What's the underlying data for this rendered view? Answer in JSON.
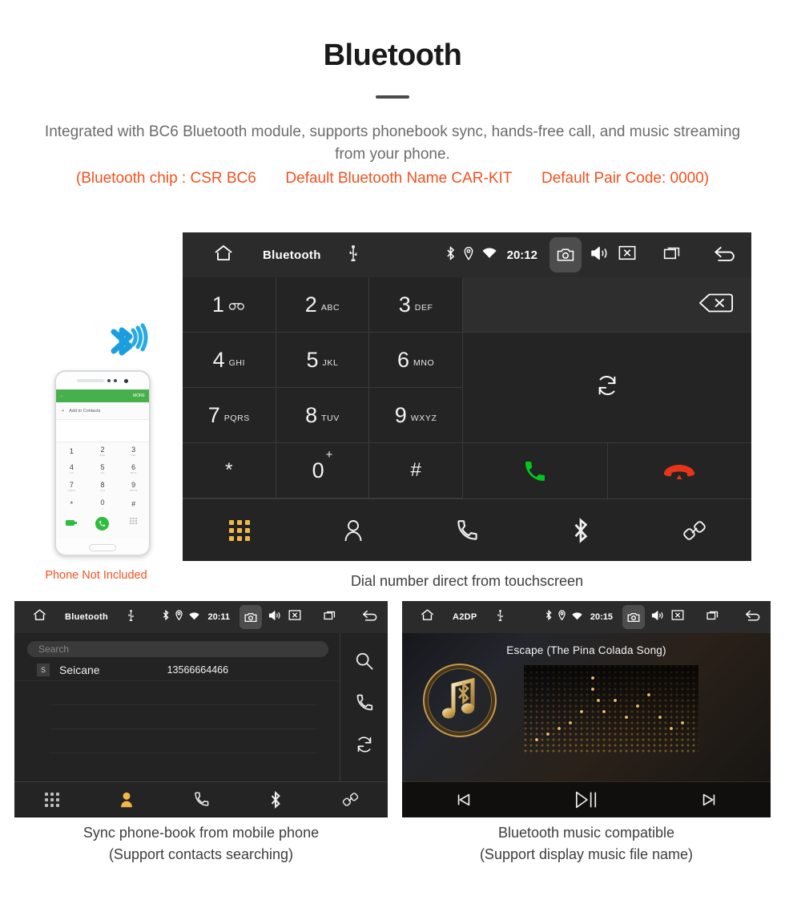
{
  "header": {
    "title": "Bluetooth",
    "description": "Integrated with BC6 Bluetooth module, supports phonebook sync, hands-free call, and music streaming from your phone.",
    "spec_open": "(Bluetooth chip : CSR BC6",
    "spec_name": "Default Bluetooth Name CAR-KIT",
    "spec_pair": "Default Pair Code: 0000)",
    "accent_color": "#f4511e"
  },
  "dialer": {
    "statusbar": {
      "title": "Bluetooth",
      "time": "20:12",
      "icons": [
        "home-icon",
        "usb-icon",
        "bluetooth-icon",
        "location-icon",
        "wifi-icon",
        "camera-icon",
        "volume-icon",
        "close-box-icon",
        "recents-icon",
        "back-icon"
      ]
    },
    "keys": [
      {
        "num": "1",
        "sub": "",
        "icon": "voicemail-icon"
      },
      {
        "num": "2",
        "sub": "ABC",
        "icon": ""
      },
      {
        "num": "3",
        "sub": "DEF",
        "icon": ""
      },
      {
        "num": "4",
        "sub": "GHI",
        "icon": ""
      },
      {
        "num": "5",
        "sub": "JKL",
        "icon": ""
      },
      {
        "num": "6",
        "sub": "MNO",
        "icon": ""
      },
      {
        "num": "7",
        "sub": "PQRS",
        "icon": ""
      },
      {
        "num": "8",
        "sub": "TUV",
        "icon": ""
      },
      {
        "num": "9",
        "sub": "WXYZ",
        "icon": ""
      },
      {
        "num": "*",
        "sub": "",
        "icon": ""
      },
      {
        "num": "0",
        "sup": "+",
        "sub": "",
        "icon": ""
      },
      {
        "num": "#",
        "sub": "",
        "icon": ""
      }
    ],
    "number_value": "",
    "actions": {
      "backspace": "backspace-icon",
      "sync": "sync-icon",
      "call": "call-icon",
      "hangup": "hangup-icon",
      "call_color": "#00c81e",
      "hangup_color": "#e8341a"
    },
    "nav": [
      {
        "name": "keypad",
        "icon": "keypad-icon",
        "active": true
      },
      {
        "name": "contacts",
        "icon": "contacts-icon",
        "active": false
      },
      {
        "name": "call-log",
        "icon": "phone-icon",
        "active": false
      },
      {
        "name": "bluetooth",
        "icon": "bluetooth-icon",
        "active": false
      },
      {
        "name": "pair",
        "icon": "link-icon",
        "active": false
      }
    ],
    "active_color": "#f0b849",
    "caption": "Dial number direct from touchscreen"
  },
  "phone_mockup": {
    "bar_label": "MORE",
    "add_label": "Add to Contacts",
    "keys": [
      {
        "num": "1",
        "sub": ""
      },
      {
        "num": "2",
        "sub": "ABC"
      },
      {
        "num": "3",
        "sub": "DEF"
      },
      {
        "num": "4",
        "sub": "GHI"
      },
      {
        "num": "5",
        "sub": "JKL"
      },
      {
        "num": "6",
        "sub": "MNO"
      },
      {
        "num": "7",
        "sub": "PQRS"
      },
      {
        "num": "8",
        "sub": "TUV"
      },
      {
        "num": "9",
        "sub": "WXYZ"
      },
      {
        "num": "*",
        "sub": ""
      },
      {
        "num": "0",
        "sub": "+"
      },
      {
        "num": "#",
        "sub": ""
      }
    ],
    "note": "Phone Not Included",
    "note_color": "#f4511e"
  },
  "phonebook": {
    "statusbar": {
      "title": "Bluetooth",
      "time": "20:11"
    },
    "search_placeholder": "Search",
    "contacts": [
      {
        "initial": "S",
        "name": "Seicane",
        "number": "13566664466"
      }
    ],
    "side_actions": [
      "search-icon",
      "call-icon",
      "sync-icon"
    ],
    "nav": [
      {
        "name": "keypad",
        "icon": "keypad-icon",
        "active": false
      },
      {
        "name": "contacts",
        "icon": "contacts-icon",
        "active": true
      },
      {
        "name": "call-log",
        "icon": "phone-icon",
        "active": false
      },
      {
        "name": "bluetooth",
        "icon": "bluetooth-icon",
        "active": false
      },
      {
        "name": "pair",
        "icon": "link-icon",
        "active": false
      }
    ],
    "caption_line1": "Sync phone-book from mobile phone",
    "caption_line2": "(Support contacts searching)"
  },
  "music": {
    "statusbar": {
      "title": "A2DP",
      "time": "20:15"
    },
    "song_title": "Escape (The Pina Colada Song)",
    "controls": [
      "previous-icon",
      "play-pause-icon",
      "next-icon"
    ],
    "caption_line1": "Bluetooth music compatible",
    "caption_line2": "(Support display music file name)"
  }
}
